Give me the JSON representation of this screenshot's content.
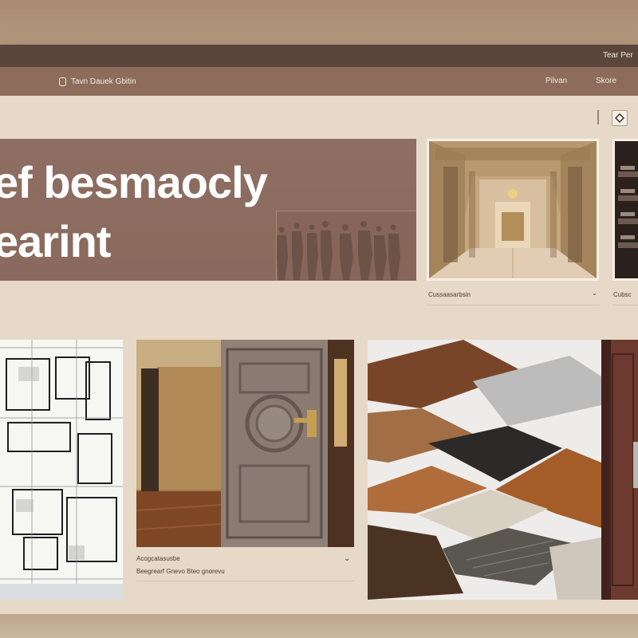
{
  "topbar": {
    "link": "Tear Per"
  },
  "navbar": {
    "brand": "Tavn Dauek Gbitin",
    "items": [
      {
        "label": "Pilvan",
        "name": "services"
      },
      {
        "label": "Skore",
        "name": "store"
      }
    ]
  },
  "hero": {
    "line1": "ef besmaocly",
    "line2": "earint"
  },
  "gallery": {
    "hallway_caption": "Cussaasarbsin",
    "shelves_caption": "Cubsc",
    "door_caption_1": "Acogcatasusbe",
    "door_caption_2": "Beegrearf Gnevo Bteo gnorevu"
  },
  "icons": {
    "brand": "door-icon",
    "tool": "diamond-icon",
    "caption_action": "chevron-icon"
  },
  "colors": {
    "accent": "#8d6c5c",
    "topbar": "#5a463c",
    "background": "#e7d9c8"
  }
}
